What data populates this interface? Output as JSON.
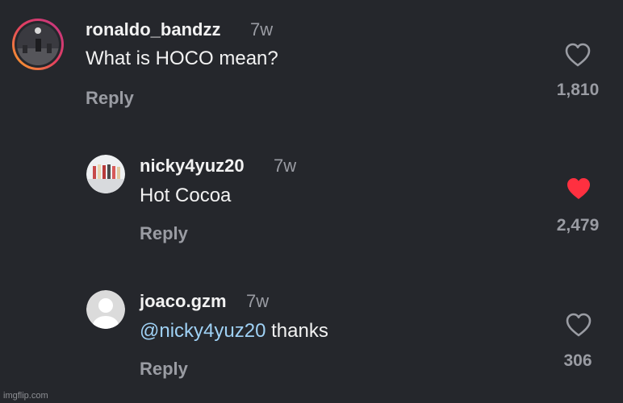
{
  "comments": [
    {
      "username": "ronaldo_bandzz",
      "age": "7w",
      "text": "What is HOCO mean?",
      "reply_label": "Reply",
      "like_count": "1,810",
      "liked": false,
      "avatar_icon": "story-ring-avatar"
    },
    {
      "username": "nicky4yuz20",
      "age": "7w",
      "text": "Hot Cocoa",
      "reply_label": "Reply",
      "like_count": "2,479",
      "liked": true,
      "avatar_icon": "group-photo-avatar"
    },
    {
      "username": "joaco.gzm",
      "age": "7w",
      "mention": "@nicky4yuz20",
      "text": " thanks",
      "reply_label": "Reply",
      "like_count": "306",
      "liked": false,
      "avatar_icon": "default-user-avatar"
    }
  ],
  "watermark": "imgflip.com",
  "colors": {
    "background": "#25272c",
    "liked_heart": "#ff3040",
    "mention": "#9fd1f5",
    "muted": "#9a9ca3"
  }
}
